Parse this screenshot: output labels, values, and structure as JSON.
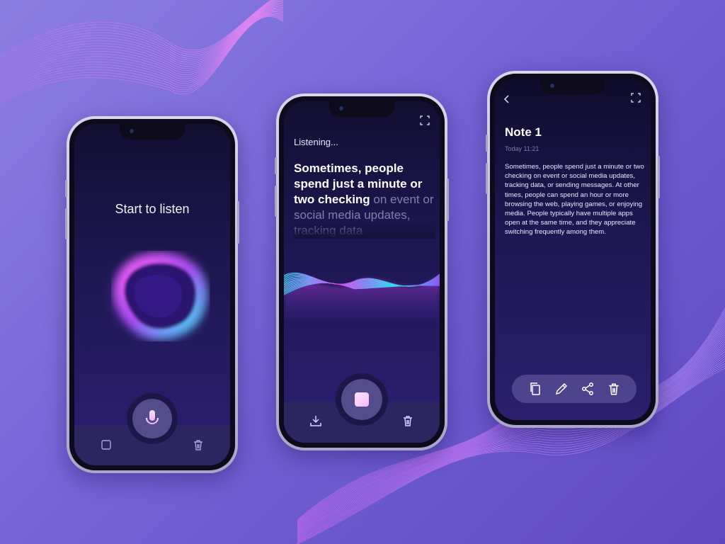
{
  "colors": {
    "accent_pink": "#e14df2",
    "accent_cyan": "#35d6f5",
    "screen_dark": "#120f31",
    "background": "#7563d6"
  },
  "phone1": {
    "title": "Start to listen",
    "icons": [
      "square-icon",
      "microphone-icon",
      "trash-icon"
    ]
  },
  "phone2": {
    "status": "Listening...",
    "transcript_spoken": "Sometimes, people spend just a minute or two checking",
    "transcript_pending": "on event or social media updates, tracking data",
    "icons": [
      "expand-icon",
      "download-icon",
      "stop-icon",
      "trash-icon"
    ]
  },
  "phone3": {
    "title": "Note 1",
    "date": "Today 11:21",
    "body": "Sometimes, people spend just a minute or two checking on event or social media updates, tracking data, or sending messages. At other times, people can spend an hour or more browsing the web, playing games, or enjoying media. People typically have multiple apps open at the same time, and they appreciate switching frequently among them.",
    "toolbar_icons": [
      "copy-icon",
      "edit-icon",
      "share-icon",
      "trash-icon"
    ]
  }
}
